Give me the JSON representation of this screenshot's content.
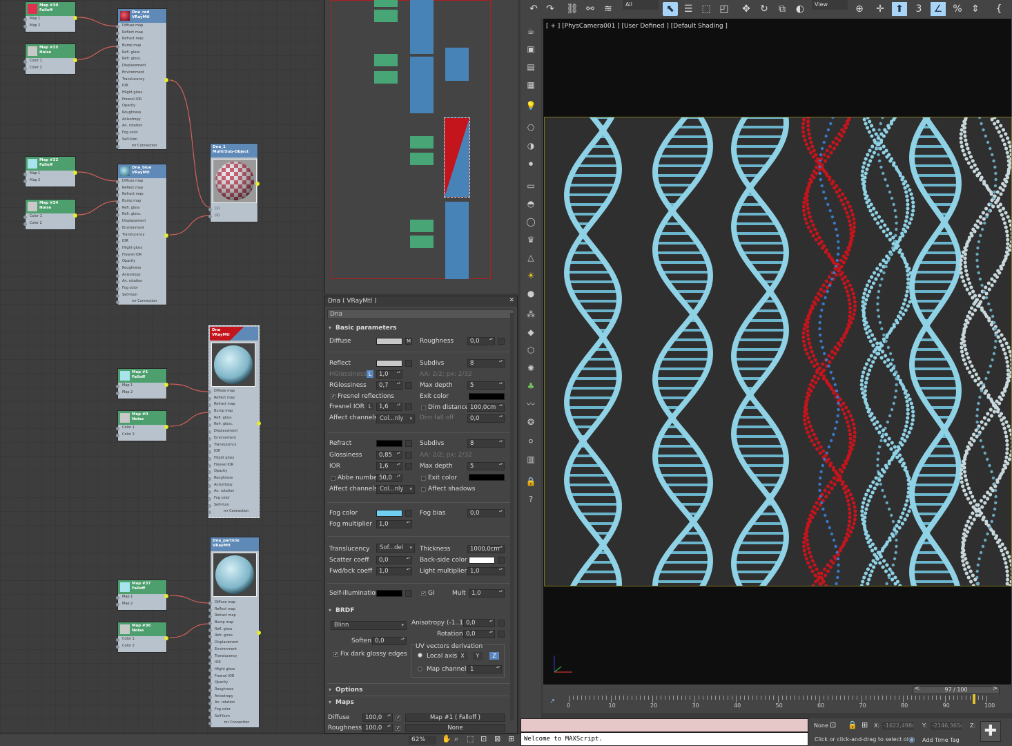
{
  "node_editor": {
    "nodes": {
      "map30": {
        "title": "Map #30",
        "type": "Falloff",
        "rows": [
          "Map 1",
          "Map 2"
        ]
      },
      "map35": {
        "title": "Map #35",
        "type": "Noise",
        "rows": [
          "Color 1",
          "Color 2"
        ]
      },
      "map32": {
        "title": "Map #32",
        "type": "Falloff",
        "rows": [
          "Map 1",
          "Map 2"
        ]
      },
      "map34": {
        "title": "Map #34",
        "type": "Noise",
        "rows": [
          "Color 1",
          "Color 2"
        ]
      },
      "map1": {
        "title": "Map #1",
        "type": "Falloff",
        "rows": [
          "Map 1",
          "Map 2"
        ]
      },
      "map0": {
        "title": "Map #0",
        "type": "Noise",
        "rows": [
          "Color 1",
          "Color 2"
        ]
      },
      "map37": {
        "title": "Map #37",
        "type": "Falloff",
        "rows": [
          "Map 1",
          "Map 2"
        ]
      },
      "map36": {
        "title": "Map #36",
        "type": "Noise",
        "rows": [
          "Color 1",
          "Color 2"
        ]
      },
      "dna_red": {
        "title": "Dna_red",
        "type": "VRayMtl"
      },
      "dna_blue": {
        "title": "Dna_blue",
        "type": "VRayMtl"
      },
      "dna": {
        "title": "Dna",
        "type": "VRayMtl"
      },
      "dna_particle": {
        "title": "Dna_particle",
        "type": "VRayMtl"
      },
      "dna1": {
        "title": "Dna_1",
        "type": "Multi/Sub-Object",
        "rows": [
          "(1)",
          "(2)"
        ]
      }
    },
    "vray_slots": [
      "Diffuse map",
      "Reflect map",
      "Refract map",
      "Bump map",
      "Refl. gloss",
      "Refr. gloss.",
      "Displacement",
      "Environment",
      "Translucency",
      "IOR",
      "Hlight gloss",
      "Fresnel IOR",
      "Opacity",
      "Roughness",
      "Anisotropy",
      "An. rotation",
      "Fog color",
      "Self-Ilum"
    ],
    "mr_connection": "mr Connection"
  },
  "material_editor": {
    "title": "Dna ( VRayMtl )",
    "name_field": "Dna",
    "basic": {
      "header": "Basic parameters",
      "diffuse": "Diffuse",
      "diffuse_m": "M",
      "roughness": "Roughness",
      "roughness_v": "0,0",
      "reflect": "Reflect",
      "subdivs": "Subdivs",
      "subdivs_v": "8",
      "hglossiness": "HGlossiness",
      "hglossiness_l": "L",
      "hglossiness_v": "1,0",
      "aa": "AA: 2/2; px: 2/32",
      "rglossiness": "RGlossiness",
      "rglossiness_v": "0,7",
      "maxdepth": "Max depth",
      "maxdepth_v": "5",
      "fresnel": "Fresnel reflections",
      "exitcolor": "Exit color",
      "fresnelior": "Fresnel IOR",
      "fresnelior_l": "L",
      "fresnelior_v": "1,6",
      "dimdist": "Dim distance",
      "dimdist_v": "100,0cm",
      "affect": "Affect channels",
      "affect_v": "Col...nly",
      "dimfall": "Dim fall off",
      "dimfall_v": "0,0",
      "refract": "Refract",
      "r_subdivs": "Subdivs",
      "r_subdivs_v": "8",
      "glossiness": "Glossiness",
      "glossiness_v": "0,85",
      "r_aa": "AA: 2/2; px: 2/32",
      "ior": "IOR",
      "ior_v": "1,6",
      "r_maxdepth": "Max depth",
      "r_maxdepth_v": "5",
      "abbe": "Abbe number",
      "abbe_v": "50,0",
      "r_exitcolor": "Exit color",
      "r_affect": "Affect channels",
      "r_affect_v": "Col...nly",
      "affectshadows": "Affect shadows",
      "fogcolor": "Fog color",
      "fogbias": "Fog bias",
      "fogbias_v": "0,0",
      "fogmult": "Fog multiplier",
      "fogmult_v": "1,0",
      "transl": "Translucency",
      "transl_v": "Sof...del",
      "thickness": "Thickness",
      "thickness_v": "1000,0cm",
      "scatter": "Scatter coeff",
      "scatter_v": "0,0",
      "backside": "Back-side color",
      "fwdbck": "Fwd/bck coeff",
      "fwdbck_v": "1,0",
      "lightmult": "Light multiplier",
      "lightmult_v": "1,0",
      "selfillum": "Self-illumination",
      "gi": "GI",
      "mult": "Mult",
      "mult_v": "1,0"
    },
    "brdf": {
      "header": "BRDF",
      "type": "Blinn",
      "aniso": "Anisotropy (-1..1)",
      "aniso_v": "0,0",
      "rotation": "Rotation",
      "rotation_v": "0,0",
      "soften": "Soften",
      "soften_v": "0,0",
      "fixdark": "Fix dark glossy edges",
      "uvderiv": "UV vectors derivation",
      "localaxis": "Local axis",
      "x": "X",
      "y": "Y",
      "z": "Z",
      "mapchannel": "Map channel",
      "mapchannel_v": "1"
    },
    "options": {
      "header": "Options"
    },
    "maps": {
      "header": "Maps",
      "rows": [
        {
          "name": "Diffuse",
          "amount": "100,0",
          "map": "Map #1 ( Falloff )"
        },
        {
          "name": "Roughness",
          "amount": "100,0",
          "map": "None"
        }
      ]
    }
  },
  "toolbar": {
    "filter": "All",
    "ref_coord": "View"
  },
  "viewport": {
    "label": "[ + ] [PhysCamera001 ] [User Defined ] [Default Shading ]"
  },
  "timeline": {
    "frame": "97 / 100",
    "frame_fraction": 0.97,
    "ticks": [
      "0",
      "10",
      "20",
      "30",
      "40",
      "50",
      "60",
      "70",
      "80",
      "90",
      "100"
    ]
  },
  "status": {
    "maxscript": "Welcome to MAXScript.",
    "selection": "None",
    "hint": "Click or click-and-drag to select ol",
    "x_label": "X:",
    "x_val": "-1622,498c",
    "y_label": "Y:",
    "y_val": "-2146,365c",
    "z_label": "Z:",
    "add_time_tag": "Add Time Tag"
  },
  "zoom": "62%",
  "colors": {
    "accent_yellow": "#e4ec2c",
    "dna_blue": "#8fd2e6",
    "dna_red": "#c4141c",
    "fog_color": "#6fd0f0"
  }
}
